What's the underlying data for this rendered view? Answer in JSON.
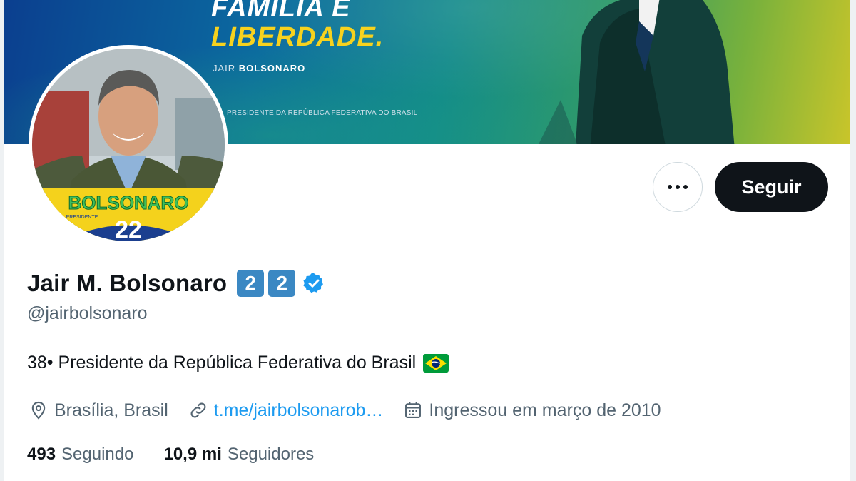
{
  "banner": {
    "headline_line1": "FAMILIA E",
    "headline_line2": "LIBERDADE.",
    "signature_first": "JAIR",
    "signature_last": "BOLSONARO",
    "subtitle": "PRESIDENTE DA REPÚBLICA FEDERATIVA DO BRASIL"
  },
  "avatar": {
    "campaign_name": "BOLSONARO",
    "campaign_role": "PRESIDENTE",
    "campaign_number": "22"
  },
  "actions": {
    "follow_label": "Seguir",
    "more_icon": "ellipsis-icon"
  },
  "profile": {
    "display_name": "Jair M. Bolsonaro",
    "badge_1": "2",
    "badge_2": "2",
    "handle": "@jairbolsonaro",
    "bio": "38• Presidente da República Federativa do Brasil",
    "location": "Brasília, Brasil",
    "link": "t.me/jairbolsonarob…",
    "joined": "Ingressou em março de 2010"
  },
  "stats": {
    "following_count": "493",
    "following_label": "Seguindo",
    "followers_count": "10,9 mi",
    "followers_label": "Seguidores"
  },
  "colors": {
    "accent": "#1d9bf0",
    "text": "#0f1419",
    "muted": "#536471",
    "follow_bg": "#0f1419",
    "badge_bg": "#3b88c3"
  }
}
